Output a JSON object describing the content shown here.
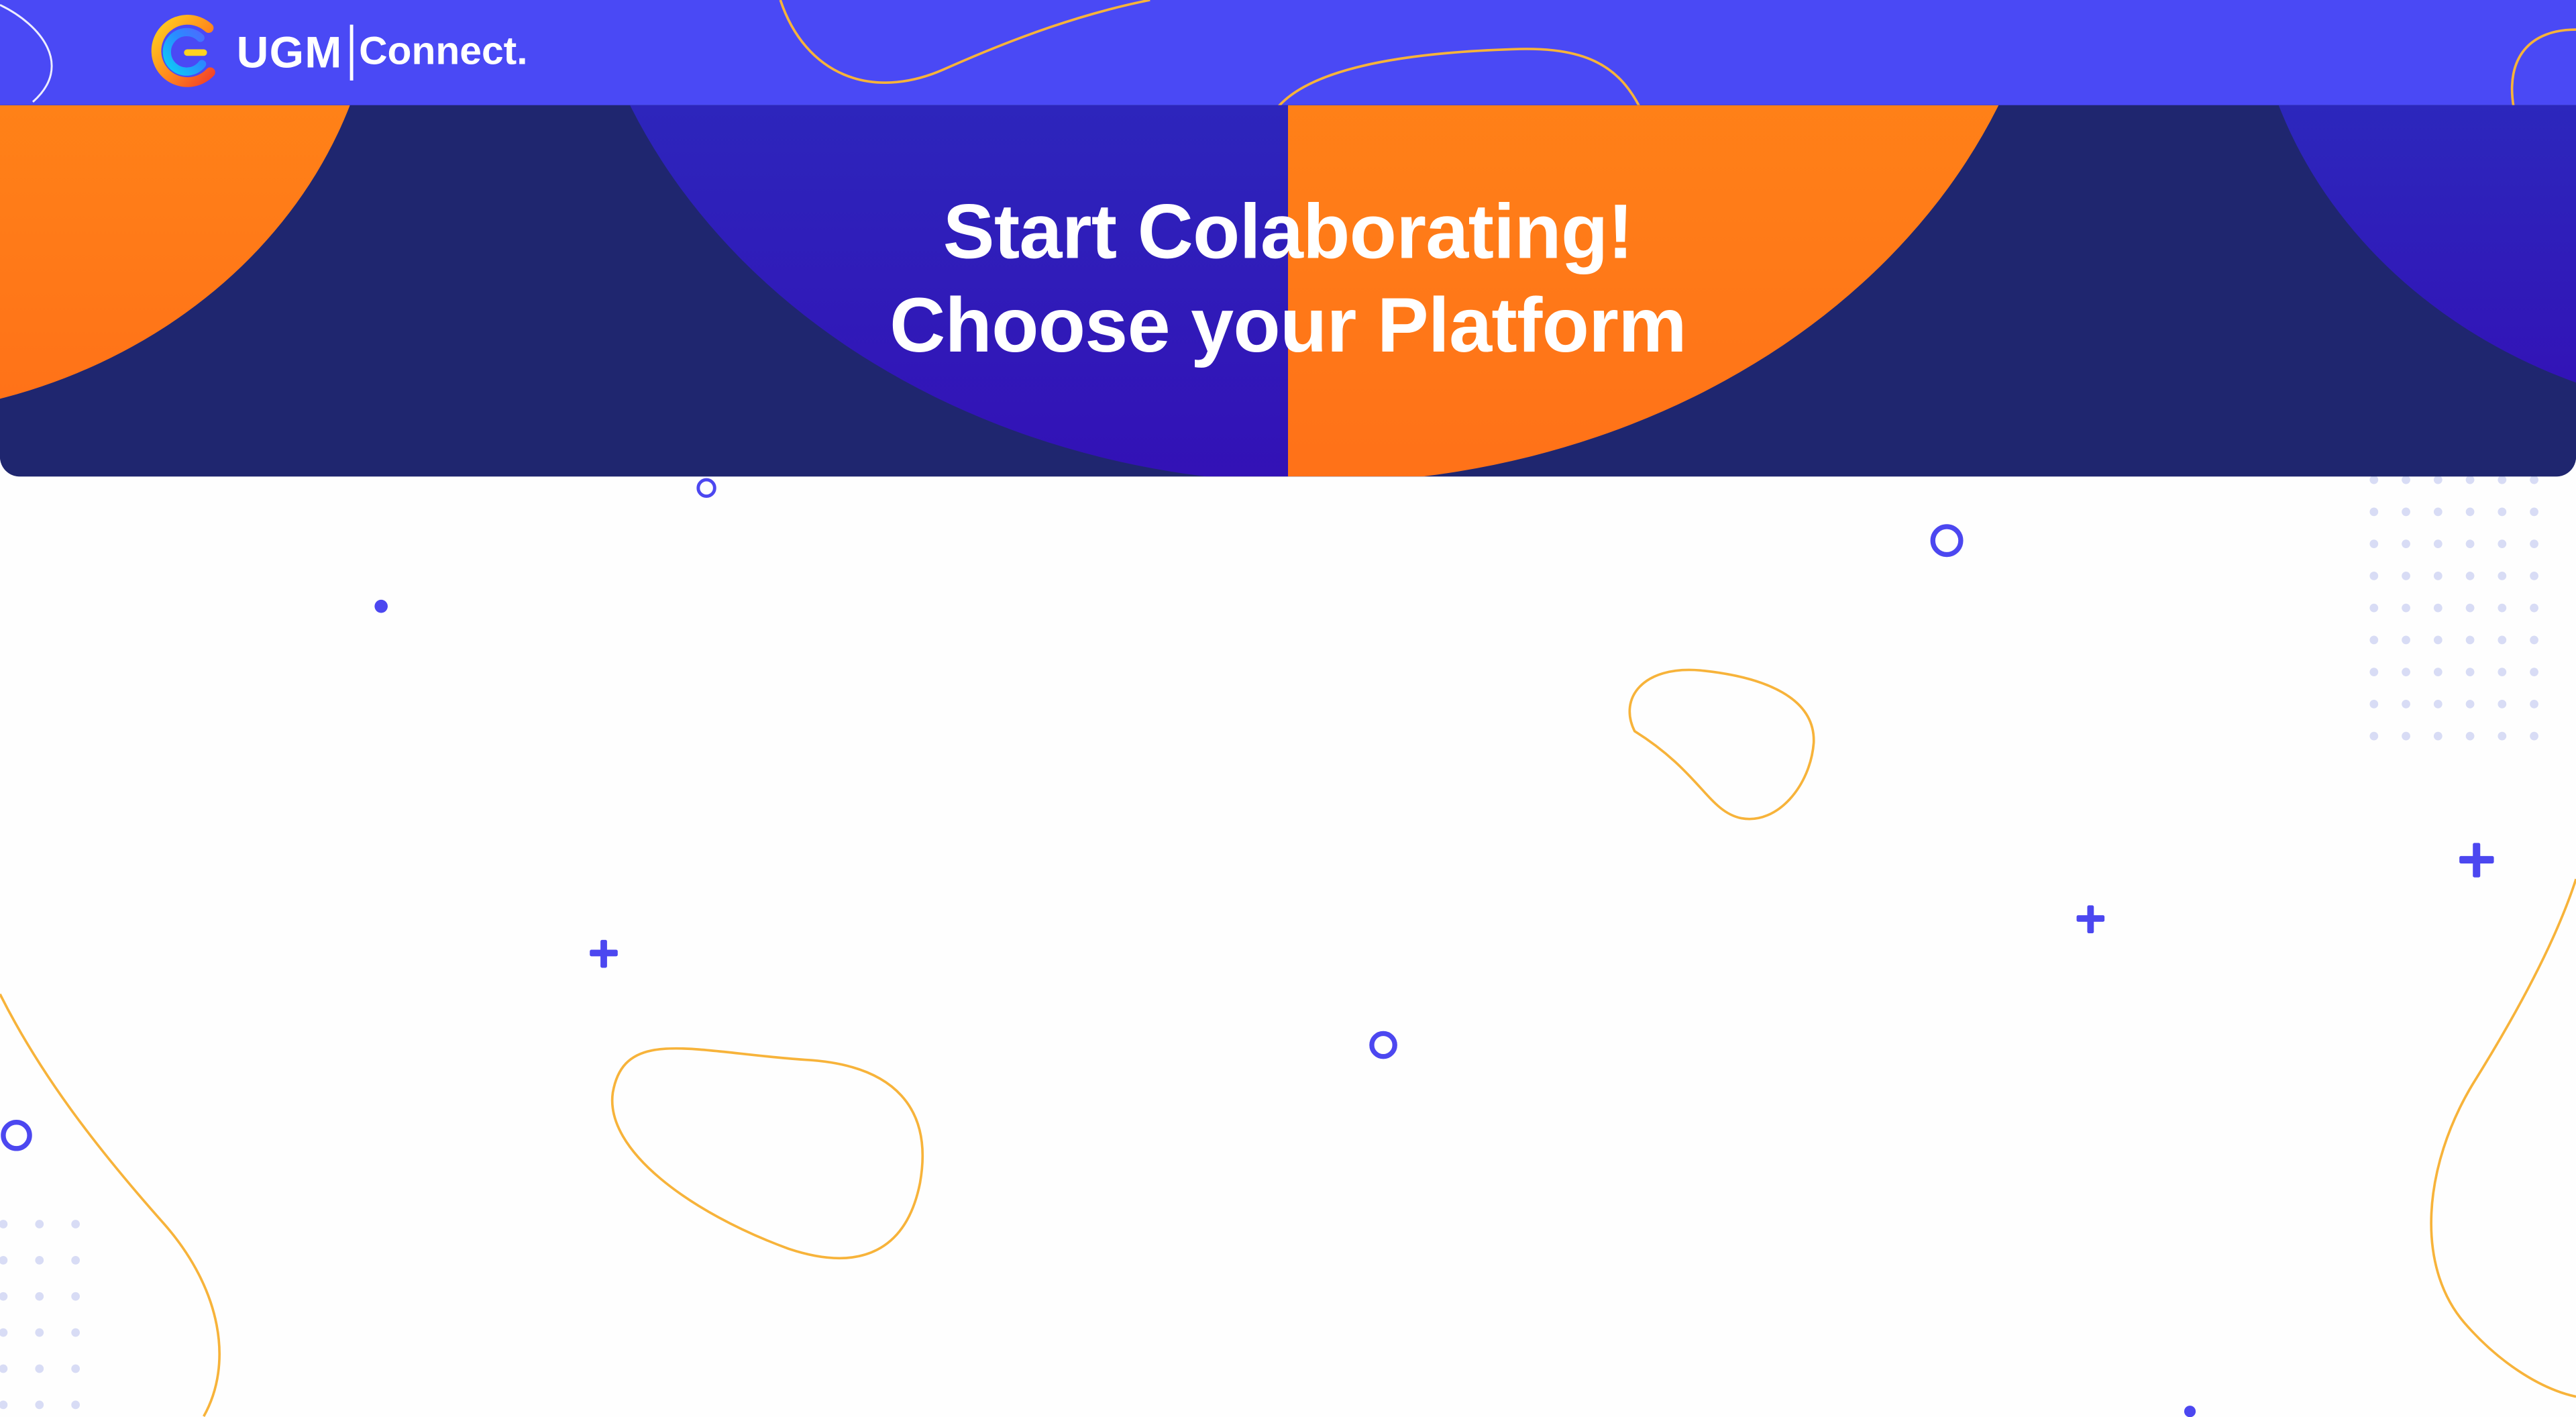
{
  "app": {
    "logo_primary": "UGM",
    "logo_secondary": "Connect."
  },
  "hero": {
    "title_line1": "Start Colaborating!",
    "title_line2": "Choose your Platform"
  },
  "colors": {
    "topbar": "#4a49f5",
    "banner_navy": "#1f266f",
    "orange_light": "#ffa116",
    "orange_dark": "#ff7118",
    "blue_light": "#1f52c8",
    "purple_dark": "#3311b6",
    "accent": "#4c47f0",
    "decor_line": "#f7b33a",
    "background": "#fefefe"
  },
  "icons": {
    "logo": "ugm-connect-logo-icon"
  }
}
